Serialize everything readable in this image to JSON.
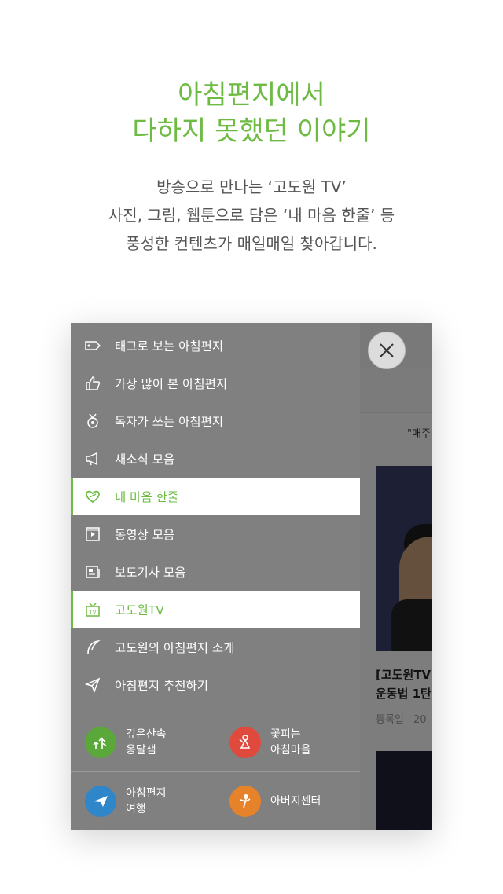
{
  "headline": {
    "line1": "아침편지에서",
    "line2": "다하지 못했던 이야기"
  },
  "description": {
    "line1": "방송으로 만나는 ‘고도원 TV’",
    "line2": "사진, 그림, 웹툰으로 담은 ‘내 마음 한줄’ 등",
    "line3": "풍성한 컨텐츠가 매일매일 찾아갑니다."
  },
  "menu": {
    "items": [
      {
        "label": "태그로 보는 아침편지",
        "icon": "tag-icon"
      },
      {
        "label": "가장 많이 본 아침편지",
        "icon": "thumbs-up-icon"
      },
      {
        "label": "독자가 쓰는 아침편지",
        "icon": "medal-icon"
      },
      {
        "label": "새소식 모음",
        "icon": "megaphone-icon"
      },
      {
        "label": "내 마음 한줄",
        "icon": "heart-leaf-icon",
        "active": true
      },
      {
        "label": "동영상 모음",
        "icon": "video-icon"
      },
      {
        "label": "보도기사 모음",
        "icon": "newspaper-icon"
      },
      {
        "label": "고도원TV",
        "icon": "tv-icon",
        "active": true
      },
      {
        "label": "고도원의 아침편지 소개",
        "icon": "leaf-icon"
      },
      {
        "label": "아침편지 추천하기",
        "icon": "send-icon"
      }
    ],
    "shortcuts": [
      {
        "line1": "깊은산속",
        "line2": "옹달샘",
        "color": "#5aa83a",
        "icon": "forest-icon"
      },
      {
        "line1": "꽃피는",
        "line2": "아침마을",
        "color": "#e04a3c",
        "icon": "flower-girl-icon"
      },
      {
        "line1": "아침편지",
        "line2": "여행",
        "color": "#2f86c8",
        "icon": "plane-icon"
      },
      {
        "line1": "아버지센터",
        "line2": "",
        "color": "#e6822a",
        "icon": "father-icon"
      }
    ]
  },
  "background": {
    "quote": "\"매주",
    "title_line1": "[고도원TV",
    "title_line2": "운동법 1탄",
    "meta_label": "등록일",
    "meta_value": "20"
  },
  "colors": {
    "accent": "#6dbb43",
    "overlay": "#808080"
  }
}
